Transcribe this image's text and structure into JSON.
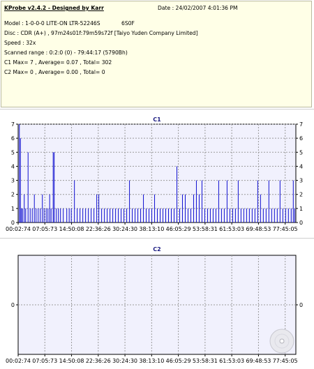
{
  "header": {
    "title": "KProbe v2.4.2 - Designed by Karr",
    "date": "Date : 24/02/2007 4:01:36 PM",
    "model": "Model : 1-0-0-0 LITE-ON LTR-52246S",
    "firmware": "6S0F",
    "disc": "Disc : CDR (A+) , 97m24s01f:79m59s72f [Taiyo Yuden Company Limited]",
    "speed": "Speed : 32x",
    "scanned_range": "Scanned range : 0:2:0 (0) - 79:44:17 (5790Bh)",
    "c1_stats": "C1 Max= 7 , Average= 0.07 , Total= 302",
    "c2_stats": "C2 Max= 0 , Average= 0.00 , Total= 0"
  },
  "colors": {
    "plot_bg": "#f1f1fd",
    "series": "#1010d0",
    "grid": "#9a9a9a",
    "info_bg": "#ffffe7"
  },
  "chart_data": [
    {
      "type": "bar",
      "title": "C1",
      "x_tick_labels": [
        "00:02:74",
        "07:05:73",
        "14:50:08",
        "22:36:26",
        "30:24:30",
        "38:13:10",
        "46:05:29",
        "53:58:31",
        "61:53:03",
        "69:48:53",
        "77:45:05"
      ],
      "ylim": [
        0,
        7
      ],
      "y_ticks": [
        0,
        1,
        2,
        3,
        4,
        5,
        6,
        7
      ],
      "grid": true,
      "x_range_minutes": [
        0.05,
        79.74
      ],
      "spikes": [
        {
          "x": 0.4,
          "y": 7
        },
        {
          "x": 0.7,
          "y": 6
        },
        {
          "x": 1.0,
          "y": 1
        },
        {
          "x": 1.3,
          "y": 1
        },
        {
          "x": 1.8,
          "y": 2
        },
        {
          "x": 2.2,
          "y": 1
        },
        {
          "x": 2.9,
          "y": 5
        },
        {
          "x": 3.5,
          "y": 1
        },
        {
          "x": 4.1,
          "y": 1
        },
        {
          "x": 4.7,
          "y": 2
        },
        {
          "x": 5.2,
          "y": 1
        },
        {
          "x": 5.8,
          "y": 1
        },
        {
          "x": 6.4,
          "y": 1
        },
        {
          "x": 7.0,
          "y": 2
        },
        {
          "x": 7.5,
          "y": 1
        },
        {
          "x": 8.1,
          "y": 1
        },
        {
          "x": 8.6,
          "y": 1
        },
        {
          "x": 9.1,
          "y": 2
        },
        {
          "x": 9.5,
          "y": 1
        },
        {
          "x": 10.1,
          "y": 5
        },
        {
          "x": 10.4,
          "y": 5
        },
        {
          "x": 11.0,
          "y": 1
        },
        {
          "x": 11.6,
          "y": 1
        },
        {
          "x": 12.2,
          "y": 1
        },
        {
          "x": 13.0,
          "y": 1
        },
        {
          "x": 14.0,
          "y": 1
        },
        {
          "x": 14.7,
          "y": 1
        },
        {
          "x": 15.3,
          "y": 1
        },
        {
          "x": 16.2,
          "y": 3
        },
        {
          "x": 17.0,
          "y": 1
        },
        {
          "x": 17.8,
          "y": 1
        },
        {
          "x": 18.6,
          "y": 1
        },
        {
          "x": 19.4,
          "y": 1
        },
        {
          "x": 20.2,
          "y": 1
        },
        {
          "x": 21.0,
          "y": 1
        },
        {
          "x": 21.8,
          "y": 1
        },
        {
          "x": 22.6,
          "y": 2
        },
        {
          "x": 23.2,
          "y": 2
        },
        {
          "x": 24.0,
          "y": 1
        },
        {
          "x": 24.8,
          "y": 1
        },
        {
          "x": 25.6,
          "y": 1
        },
        {
          "x": 26.4,
          "y": 1
        },
        {
          "x": 27.2,
          "y": 1
        },
        {
          "x": 28.0,
          "y": 1
        },
        {
          "x": 28.8,
          "y": 1
        },
        {
          "x": 29.6,
          "y": 1
        },
        {
          "x": 30.4,
          "y": 1
        },
        {
          "x": 31.2,
          "y": 1
        },
        {
          "x": 32.0,
          "y": 3
        },
        {
          "x": 32.8,
          "y": 1
        },
        {
          "x": 33.6,
          "y": 1
        },
        {
          "x": 34.4,
          "y": 1
        },
        {
          "x": 35.2,
          "y": 1
        },
        {
          "x": 36.0,
          "y": 2
        },
        {
          "x": 36.8,
          "y": 1
        },
        {
          "x": 37.6,
          "y": 1
        },
        {
          "x": 38.4,
          "y": 1
        },
        {
          "x": 39.2,
          "y": 2
        },
        {
          "x": 40.0,
          "y": 1
        },
        {
          "x": 40.8,
          "y": 1
        },
        {
          "x": 41.6,
          "y": 1
        },
        {
          "x": 42.4,
          "y": 1
        },
        {
          "x": 43.2,
          "y": 1
        },
        {
          "x": 44.0,
          "y": 1
        },
        {
          "x": 44.8,
          "y": 1
        },
        {
          "x": 45.6,
          "y": 4
        },
        {
          "x": 46.4,
          "y": 1
        },
        {
          "x": 47.2,
          "y": 2
        },
        {
          "x": 48.0,
          "y": 2
        },
        {
          "x": 48.8,
          "y": 1
        },
        {
          "x": 49.6,
          "y": 1
        },
        {
          "x": 50.4,
          "y": 2
        },
        {
          "x": 51.2,
          "y": 3
        },
        {
          "x": 52.0,
          "y": 2
        },
        {
          "x": 52.8,
          "y": 3
        },
        {
          "x": 53.6,
          "y": 1
        },
        {
          "x": 54.4,
          "y": 1
        },
        {
          "x": 55.2,
          "y": 1
        },
        {
          "x": 56.0,
          "y": 1
        },
        {
          "x": 56.8,
          "y": 1
        },
        {
          "x": 57.6,
          "y": 3
        },
        {
          "x": 58.4,
          "y": 1
        },
        {
          "x": 59.2,
          "y": 1
        },
        {
          "x": 60.0,
          "y": 3
        },
        {
          "x": 60.8,
          "y": 1
        },
        {
          "x": 61.6,
          "y": 1
        },
        {
          "x": 62.4,
          "y": 1
        },
        {
          "x": 63.2,
          "y": 3
        },
        {
          "x": 64.0,
          "y": 1
        },
        {
          "x": 64.8,
          "y": 1
        },
        {
          "x": 65.6,
          "y": 1
        },
        {
          "x": 66.4,
          "y": 1
        },
        {
          "x": 67.2,
          "y": 1
        },
        {
          "x": 68.0,
          "y": 1
        },
        {
          "x": 68.8,
          "y": 3
        },
        {
          "x": 69.6,
          "y": 2
        },
        {
          "x": 70.4,
          "y": 1
        },
        {
          "x": 71.2,
          "y": 1
        },
        {
          "x": 72.0,
          "y": 3
        },
        {
          "x": 72.8,
          "y": 1
        },
        {
          "x": 73.6,
          "y": 1
        },
        {
          "x": 74.4,
          "y": 1
        },
        {
          "x": 75.2,
          "y": 3
        },
        {
          "x": 76.0,
          "y": 1
        },
        {
          "x": 76.8,
          "y": 1
        },
        {
          "x": 77.6,
          "y": 1
        },
        {
          "x": 78.4,
          "y": 1
        },
        {
          "x": 79.0,
          "y": 3
        },
        {
          "x": 79.4,
          "y": 1
        }
      ]
    },
    {
      "type": "bar",
      "title": "C2",
      "x_tick_labels": [
        "00:02:74",
        "07:05:73",
        "14:50:08",
        "22:36:26",
        "30:24:30",
        "38:13:10",
        "46:05:29",
        "53:58:31",
        "61:53:03",
        "69:48:53",
        "77:45:05"
      ],
      "ylim": [
        0,
        0
      ],
      "y_ticks": [
        0
      ],
      "grid": true,
      "x_range_minutes": [
        0.05,
        79.74
      ],
      "spikes": []
    }
  ]
}
